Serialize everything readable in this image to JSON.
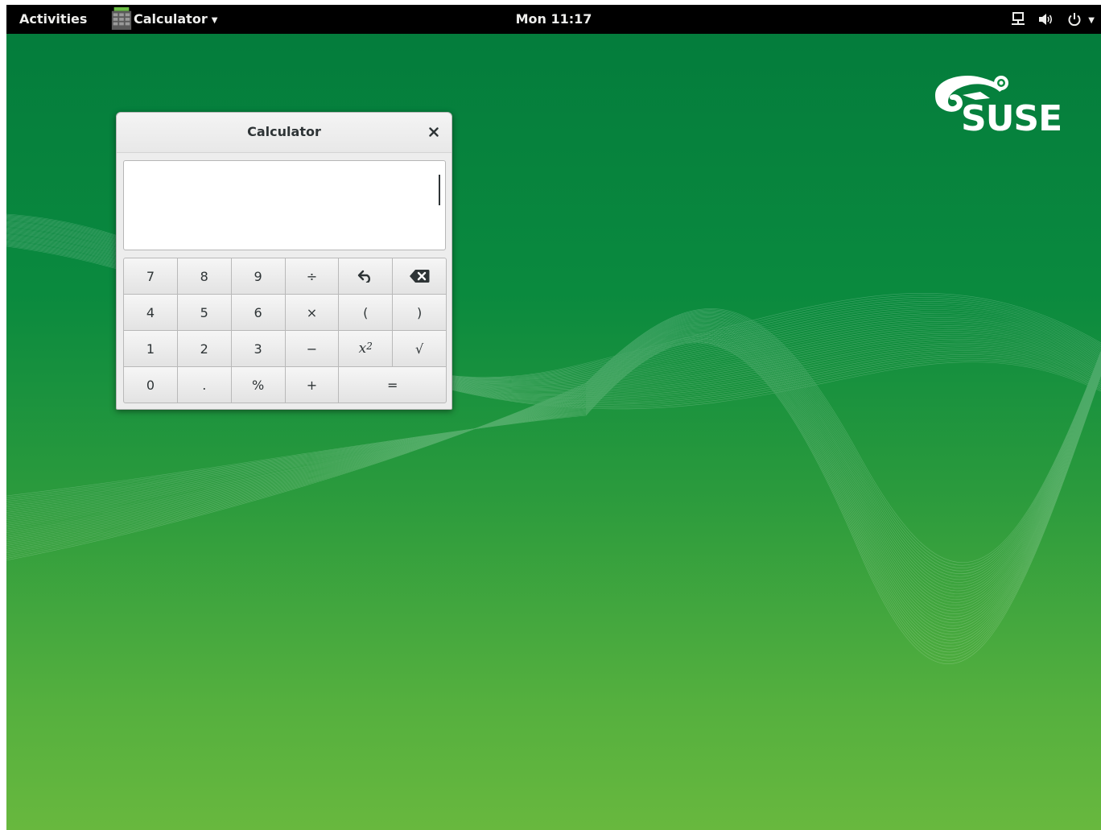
{
  "topbar": {
    "activities_label": "Activities",
    "app_menu_label": "Calculator",
    "clock": "Mon 11:17",
    "status_icons": [
      "network-wired-icon",
      "volume-icon",
      "power-icon"
    ]
  },
  "desktop": {
    "logo_text": "SUSE",
    "background_colors": [
      "#037b3c",
      "#68b83e"
    ]
  },
  "calculator": {
    "title": "Calculator",
    "display_value": "",
    "keys": [
      [
        "7",
        "8",
        "9",
        "÷",
        "undo-icon",
        "backspace-icon"
      ],
      [
        "4",
        "5",
        "6",
        "×",
        "(",
        ")"
      ],
      [
        "1",
        "2",
        "3",
        "−",
        "x²",
        "√"
      ],
      [
        "0",
        ".",
        "%",
        "+",
        "="
      ]
    ],
    "key_labels": {
      "seven": "7",
      "eight": "8",
      "nine": "9",
      "divide": "÷",
      "four": "4",
      "five": "5",
      "six": "6",
      "multiply": "×",
      "lparen": "(",
      "rparen": ")",
      "one": "1",
      "two": "2",
      "three": "3",
      "subtract": "−",
      "x": "x",
      "square_exp": "2",
      "sqrt": "√",
      "zero": "0",
      "point": ".",
      "percent": "%",
      "add": "+",
      "equals": "="
    }
  }
}
